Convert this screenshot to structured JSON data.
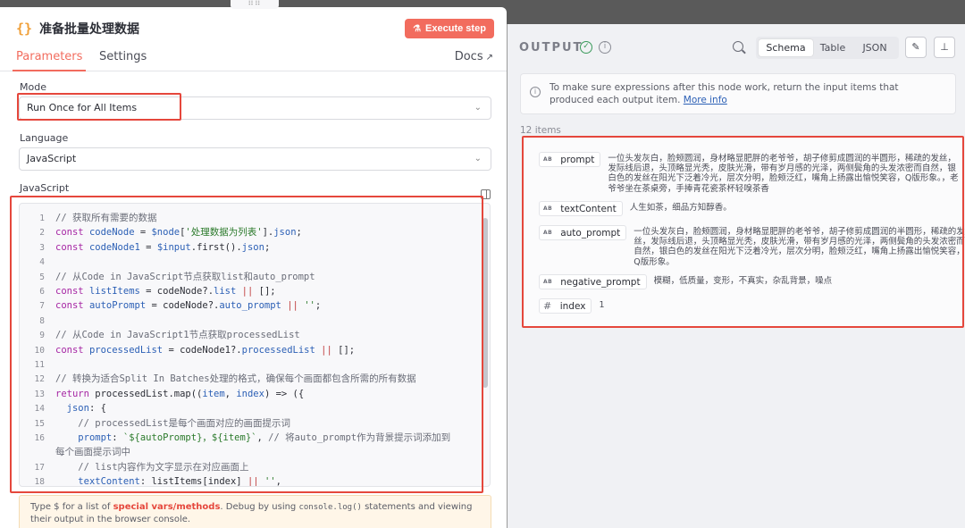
{
  "node": {
    "icon": "{}",
    "title": "准备批量处理数据",
    "execute_label": "Execute step"
  },
  "tabs": {
    "parameters": "Parameters",
    "settings": "Settings",
    "docs": "Docs"
  },
  "mode": {
    "label": "Mode",
    "value": "Run Once for All Items"
  },
  "language": {
    "label": "Language",
    "value": "JavaScript"
  },
  "editor": {
    "label": "JavaScript"
  },
  "hint": {
    "part1": "Type $ for a list of ",
    "accent": "special vars/methods",
    "part2": ". Debug by using ",
    "code": "console.log()",
    "part3": " statements and viewing their output in the browser console."
  },
  "output": {
    "title": "OUTPUT",
    "views": [
      "Schema",
      "Table",
      "JSON"
    ],
    "active_view": "Schema",
    "notice_text": "To make sure expressions after this node work, return the input items that produced each output item.",
    "notice_link": "More info",
    "items_count": "12 items",
    "fields": [
      {
        "key": "prompt",
        "type": "AB",
        "value": "一位头发灰白，脸颊圆润，身材略显肥胖的老爷爷，胡子修剪成圆润的半圆形，稀疏的发丝，发际线后退，头顶略显光秃，皮肤光滑，带有岁月感的光泽，两侧鬓角的头发浓密而自然，银白色的发丝在阳光下泛着冷光，层次分明，脸颊泛红，嘴角上扬露出愉悦笑容，Q版形象。，老爷爷坐在茶桌旁，手捧青花瓷茶杯轻嗅茶香"
      },
      {
        "key": "textContent",
        "type": "AB",
        "value": "人生如茶，细品方知醇香。"
      },
      {
        "key": "auto_prompt",
        "type": "AB",
        "value": "一位头发灰白，脸颊圆润，身材略显肥胖的老爷爷，胡子修剪成圆润的半圆形，稀疏的发丝，发际线后退，头顶略显光秃，皮肤光滑，带有岁月感的光泽，两侧鬓角的头发浓密而自然，银白色的发丝在阳光下泛着冷光，层次分明，脸颊泛红，嘴角上扬露出愉悦笑容，Q版形象。"
      },
      {
        "key": "negative_prompt",
        "type": "AB",
        "value": "模糊，低质量，变形，不真实，杂乱背景，噪点"
      },
      {
        "key": "index",
        "type": "#",
        "value": "1"
      }
    ]
  },
  "code_lines": [
    {
      "n": "1",
      "html": "<span class='com'>// 获取所有需要的数据</span>"
    },
    {
      "n": "2",
      "html": "<span class='kw'>const</span> <span class='var'>codeNode</span> = <span class='var'>$node</span>[<span class='str'>'处理数据为列表'</span>].<span class='var'>json</span>;"
    },
    {
      "n": "3",
      "html": "<span class='kw'>const</span> <span class='var'>codeNode1</span> = <span class='var'>$input</span>.first().<span class='var'>json</span>;"
    },
    {
      "n": "4",
      "html": ""
    },
    {
      "n": "5",
      "html": "<span class='com'>// 从Code in JavaScript节点获取list和auto_prompt</span>"
    },
    {
      "n": "6",
      "html": "<span class='kw'>const</span> <span class='var'>listItems</span> = codeNode?.<span class='var'>list</span> <span class='op'>||</span> [];"
    },
    {
      "n": "7",
      "html": "<span class='kw'>const</span> <span class='var'>autoPrompt</span> = codeNode?.<span class='var'>auto_prompt</span> <span class='op'>||</span> <span class='str'>''</span>;"
    },
    {
      "n": "8",
      "html": ""
    },
    {
      "n": "9",
      "html": "<span class='com'>// 从Code in JavaScript1节点获取processedList</span>"
    },
    {
      "n": "10",
      "html": "<span class='kw'>const</span> <span class='var'>processedList</span> = codeNode1?.<span class='var'>processedList</span> <span class='op'>||</span> [];"
    },
    {
      "n": "11",
      "html": ""
    },
    {
      "n": "12",
      "html": "<span class='com'>// 转换为适合Split In Batches处理的格式，确保每个画面都包含所需的所有数据</span>"
    },
    {
      "n": "13",
      "html": "<span class='kw'>return</span> processedList.map((<span class='var'>item</span>, <span class='var'>index</span>) => ({"
    },
    {
      "n": "14",
      "html": "  <span class='var'>json</span>: {"
    },
    {
      "n": "15",
      "html": "    <span class='com'>// processedList是每个画面对应的画面提示词</span>"
    },
    {
      "n": "16",
      "html": "    <span class='var'>prompt</span>: <span class='str'>`${autoPrompt}，${item}`</span>, <span class='com'>// 将auto_prompt作为背景提示词添加到</span>"
    },
    {
      "n": "",
      "html": "<span class='com'>每个画面提示词中</span>"
    },
    {
      "n": "17",
      "html": "    <span class='com'>// list内容作为文字显示在对应画面上</span>"
    },
    {
      "n": "18",
      "html": "    <span class='var'>textContent</span>: listItems[index] <span class='op'>||</span> <span class='str'>''</span>,"
    }
  ]
}
